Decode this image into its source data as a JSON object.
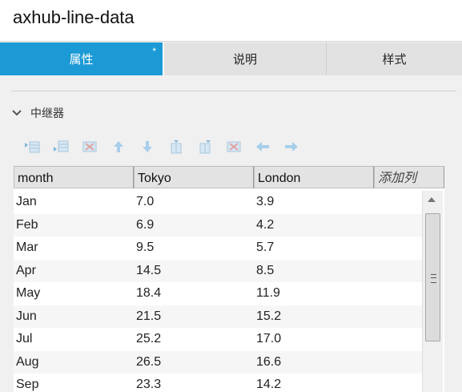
{
  "window": {
    "title": "axhub-line-data"
  },
  "tabs": [
    {
      "label": "属性",
      "mark": "*",
      "active": true
    },
    {
      "label": "说明",
      "active": false
    },
    {
      "label": "样式",
      "active": false
    }
  ],
  "section": {
    "label": "中继器",
    "expanded": true
  },
  "toolbar": {
    "icons": [
      "insert-row-above-icon",
      "insert-row-below-icon",
      "delete-row-icon",
      "move-up-icon",
      "move-down-icon",
      "insert-column-left-icon",
      "insert-column-right-icon",
      "delete-column-icon",
      "move-left-icon",
      "move-right-icon"
    ]
  },
  "grid": {
    "columns": [
      "month",
      "Tokyo",
      "London",
      "添加列"
    ],
    "rows": [
      [
        "Jan",
        "7.0",
        "3.9"
      ],
      [
        "Feb",
        "6.9",
        "4.2"
      ],
      [
        "Mar",
        "9.5",
        "5.7"
      ],
      [
        "Apr",
        "14.5",
        "8.5"
      ],
      [
        "May",
        "18.4",
        "11.9"
      ],
      [
        "Jun",
        "21.5",
        "15.2"
      ],
      [
        "Jul",
        "25.2",
        "17.0"
      ],
      [
        "Aug",
        "26.5",
        "16.6"
      ],
      [
        "Sep",
        "23.3",
        "14.2"
      ]
    ]
  }
}
